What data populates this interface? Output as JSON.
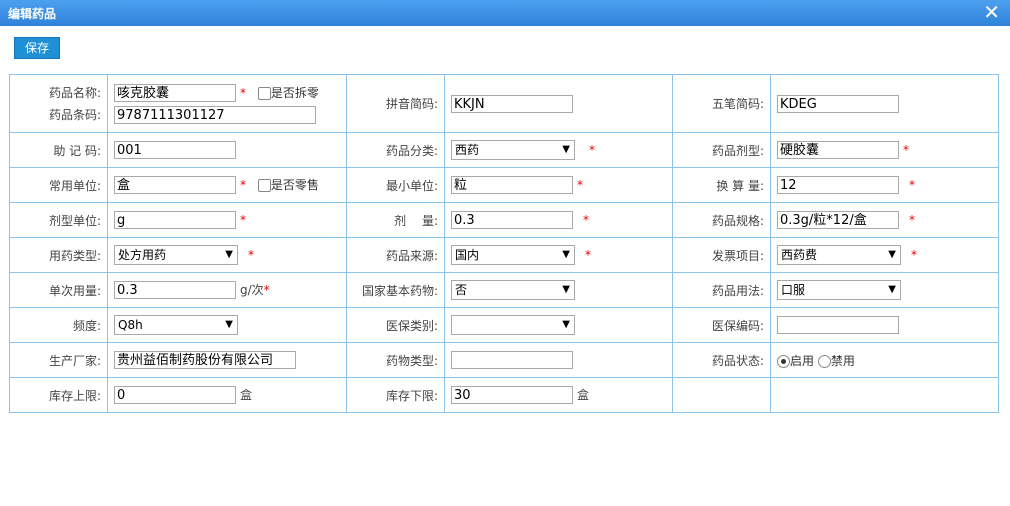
{
  "dialog": {
    "title": "编辑药品",
    "close_glyph": "✕"
  },
  "toolbar": {
    "save_label": "保存"
  },
  "row1": {
    "name_label": "药品名称:",
    "name_value": "咳克胶囊",
    "split_label": "是否拆零",
    "barcode_label": "药品条码:",
    "barcode_value": "9787111301127",
    "pinyin_label": "拼音简码:",
    "pinyin_value": "KKJN",
    "wubi_label": "五笔简码:",
    "wubi_value": "KDEG"
  },
  "row2": {
    "mnemonic_label": "助 记 码:",
    "mnemonic_value": "001",
    "category_label": "药品分类:",
    "category_value": "西药",
    "dosage_form_label": "药品剂型:",
    "dosage_form_value": "硬胶囊"
  },
  "row3": {
    "unit_label": "常用单位:",
    "unit_value": "盒",
    "retail_label": "是否零售",
    "min_unit_label": "最小单位:",
    "min_unit_value": "粒",
    "conversion_label": "换 算 量:",
    "conversion_value": "12"
  },
  "row4": {
    "form_unit_label": "剂型单位:",
    "form_unit_value": "g",
    "dose_label": "剂　 量:",
    "dose_value": "0.3",
    "spec_label": "药品规格:",
    "spec_value": "0.3g/粒*12/盒"
  },
  "row5": {
    "type_label": "用药类型:",
    "type_value": "处方用药",
    "source_label": "药品来源:",
    "source_value": "国内",
    "invoice_label": "发票项目:",
    "invoice_value": "西药费"
  },
  "row6": {
    "single_dose_label": "单次用量:",
    "single_dose_value": "0.3",
    "single_dose_unit": "g/次",
    "essential_label": "国家基本药物:",
    "essential_value": "否",
    "usage_label": "药品用法:",
    "usage_value": "口服"
  },
  "row7": {
    "freq_label": "频度:",
    "freq_value": "Q8h",
    "insurance_cat_label": "医保类别:",
    "insurance_cat_value": "",
    "insurance_code_label": "医保编码:",
    "insurance_code_value": ""
  },
  "row8": {
    "maker_label": "生产厂家:",
    "maker_value": "贵州益佰制药股份有限公司",
    "drug_type_label": "药物类型:",
    "drug_type_value": "",
    "status_label": "药品状态:",
    "status_on": "启用",
    "status_off": "禁用"
  },
  "row9": {
    "stock_max_label": "库存上限:",
    "stock_max_value": "0",
    "stock_max_unit": "盒",
    "stock_min_label": "库存下限:",
    "stock_min_value": "30",
    "stock_min_unit": "盒"
  },
  "required_mark": "*",
  "colors": {
    "titlebar": "#2f82d8",
    "border": "#8cc3ea",
    "required": "#e00000",
    "button": "#1f8fd6"
  }
}
